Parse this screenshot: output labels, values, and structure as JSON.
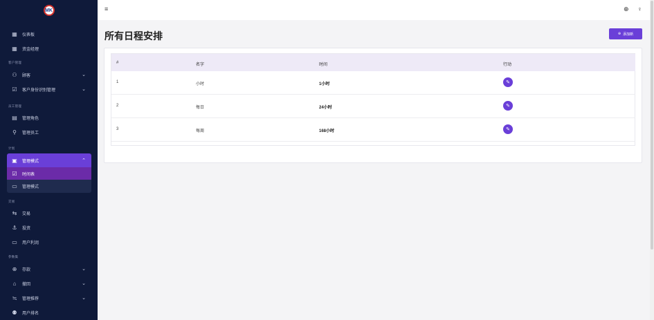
{
  "logo": {
    "text": "MK"
  },
  "sidebar": {
    "items": [
      {
        "icon": "grid-icon",
        "glyph": "▦",
        "label": "仪表板"
      },
      {
        "icon": "grid-icon",
        "glyph": "▦",
        "label": "资金经理"
      }
    ],
    "section_customers": "客户管理",
    "customers": [
      {
        "icon": "users-icon",
        "glyph": "⚇",
        "label": "顾客"
      },
      {
        "icon": "checkbox-icon",
        "glyph": "☑",
        "label": "客户身份识别管理"
      }
    ],
    "section_staff": "员工管理",
    "staff": [
      {
        "icon": "clipboard-icon",
        "glyph": "▤",
        "label": "管理角色"
      },
      {
        "icon": "user-add-icon",
        "glyph": "⚲",
        "label": "管理员工"
      }
    ],
    "section_plan": "计划",
    "plan": {
      "icon": "calendar-icon",
      "glyph": "▣",
      "label": "管理模式"
    },
    "plan_sub": [
      {
        "icon": "checkbox-icon",
        "glyph": "☑",
        "label": "时间表"
      },
      {
        "icon": "monitor-icon",
        "glyph": "▭",
        "label": "管理模式"
      }
    ],
    "section_trade": "交易",
    "trade": [
      {
        "icon": "transfer-icon",
        "glyph": "⇆",
        "label": "交易"
      },
      {
        "icon": "anchor-icon",
        "glyph": "⚓",
        "label": "投资"
      },
      {
        "icon": "card-icon",
        "glyph": "▭",
        "label": "用户利润"
      }
    ],
    "section_fund": "参数集",
    "fund": [
      {
        "icon": "plus-circle-icon",
        "glyph": "⊕",
        "label": "存款"
      },
      {
        "icon": "bank-icon",
        "glyph": "⌂",
        "label": "撤回"
      },
      {
        "icon": "sliders-icon",
        "glyph": "≒",
        "label": "管理推荐"
      },
      {
        "icon": "user-badge-icon",
        "glyph": "⚉",
        "label": "用户排名"
      }
    ]
  },
  "header": {
    "menu_glyph": "≡",
    "globe_glyph": "⊕",
    "user_glyph": "♀"
  },
  "page": {
    "title": "所有日程安排",
    "add_button": "添加新",
    "add_glyph": "⊕"
  },
  "table": {
    "headers": [
      "#",
      "名字",
      "时间",
      "行动"
    ],
    "rows": [
      {
        "id": "1",
        "name": "小时",
        "time": "1小时"
      },
      {
        "id": "2",
        "name": "每日",
        "time": "24小时"
      },
      {
        "id": "3",
        "name": "每周",
        "time": "168小时"
      }
    ],
    "edit_glyph": "✎"
  }
}
